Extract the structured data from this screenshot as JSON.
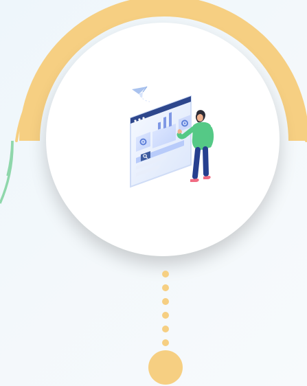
{
  "theme": {
    "accent_yellow": "#f6cf82",
    "accent_green": "#8fd7ab",
    "background": "#f3f8fb"
  },
  "illustration": {
    "icon_name": "web-design-illustration"
  },
  "timeline": {
    "dots": 6
  }
}
